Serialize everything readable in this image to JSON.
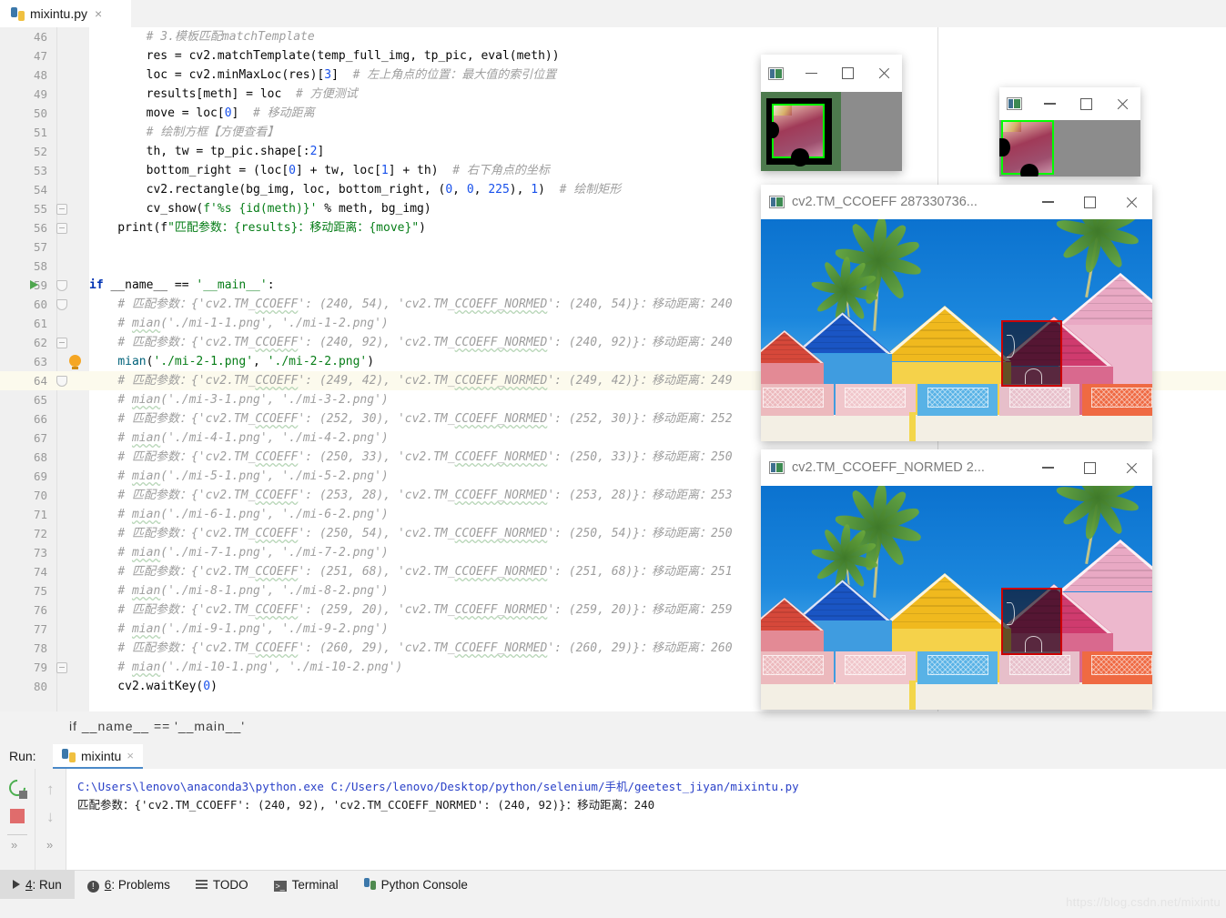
{
  "window": {
    "tab": {
      "filename": "mixintu.py",
      "close": "×",
      "icon": "python-file-icon"
    }
  },
  "editor": {
    "first_line": 46,
    "current_line": 64,
    "preview_text": "if __name__ == '__main__'",
    "lines": [
      {
        "n": 46,
        "html": "        <span class='cmt'># 3.模板匹配matchTemplate</span>"
      },
      {
        "n": 47,
        "html": "        res = cv2.matchTemplate(temp_full_img, tp_pic, eval(meth))"
      },
      {
        "n": 48,
        "html": "        loc = cv2.minMaxLoc(res)[<span class='num'>3</span>]  <span class='cmt'># 左上角点的位置：最大值的索引位置</span>"
      },
      {
        "n": 49,
        "html": "        results[meth] = loc  <span class='cmt'># 方便测试</span>"
      },
      {
        "n": 50,
        "html": "        move = loc[<span class='num'>0</span>]  <span class='cmt'># 移动距离</span>"
      },
      {
        "n": 51,
        "html": "        <span class='cmt'># 绘制方框【方便查看】</span>"
      },
      {
        "n": 52,
        "html": "        th, tw = tp_pic.shape[:<span class='num'>2</span>]"
      },
      {
        "n": 53,
        "html": "        bottom_right = (loc[<span class='num'>0</span>] + tw, loc[<span class='num'>1</span>] + th)  <span class='cmt'># 右下角点的坐标</span>"
      },
      {
        "n": 54,
        "html": "        cv2.rectangle(bg_img, loc, bottom_right, (<span class='num'>0</span>, <span class='num'>0</span>, <span class='num'>225</span>), <span class='num'>1</span>)  <span class='cmt'># 绘制矩形</span>"
      },
      {
        "n": 55,
        "html": "        cv_show(<span class='str'>f'%s {id(meth)}'</span> % meth, bg_img)",
        "fold": "minus"
      },
      {
        "n": 56,
        "html": "    print(f<span class='str'>\"匹配参数：{results}：移动距离：{move}\"</span>)",
        "fold": "minus"
      },
      {
        "n": 57,
        "html": ""
      },
      {
        "n": 58,
        "html": ""
      },
      {
        "n": 59,
        "html": "<span class='kw'>if</span> __name__ == <span class='str'>'__main__'</span>:",
        "run": true,
        "fold": "open"
      },
      {
        "n": 60,
        "html": "    <span class='cmt'># 匹配参数：{'cv2.TM_<span class='sqg'>CCOEFF</span>': (240, 54), 'cv2.TM_<span class='sqg'>CCOEFF_NORMED</span>': (240, 54)}：移动距离：240</span>",
        "fold": "open"
      },
      {
        "n": 61,
        "html": "    <span class='cmt'># <span class='sqg'>mian</span>('./mi-1-1.png', './mi-1-2.png')</span>"
      },
      {
        "n": 62,
        "html": "    <span class='cmt'># 匹配参数：{'cv2.TM_<span class='sqg'>CCOEFF</span>': (240, 92), 'cv2.TM_<span class='sqg'>CCOEFF_NORMED</span>': (240, 92)}：移动距离：240</span>",
        "fold": "minus"
      },
      {
        "n": 63,
        "html": "    <span class='fn'>mian</span>(<span class='str'>'./mi-2-1.png'</span>, <span class='str'>'./mi-2-2.png'</span>)",
        "bulb": true
      },
      {
        "n": 64,
        "html": "    <span class='cmt'># 匹配参数：{'cv2.TM_<span class='sqg'>CCOEFF</span>': (249, 42), 'cv2.TM_<span class='sqg'>CCOEFF_NORMED</span>': (249, 42)}：移动距离：249</span>",
        "hl": true,
        "fold": "open"
      },
      {
        "n": 65,
        "html": "    <span class='cmt'># <span class='sqg'>mian</span>('./mi-3-1.png', './mi-3-2.png')</span>"
      },
      {
        "n": 66,
        "html": "    <span class='cmt'># 匹配参数：{'cv2.TM_<span class='sqg'>CCOEFF</span>': (252, 30), 'cv2.TM_<span class='sqg'>CCOEFF_NORMED</span>': (252, 30)}：移动距离：252</span>"
      },
      {
        "n": 67,
        "html": "    <span class='cmt'># <span class='sqg'>mian</span>('./mi-4-1.png', './mi-4-2.png')</span>"
      },
      {
        "n": 68,
        "html": "    <span class='cmt'># 匹配参数：{'cv2.TM_<span class='sqg'>CCOEFF</span>': (250, 33), 'cv2.TM_<span class='sqg'>CCOEFF_NORMED</span>': (250, 33)}：移动距离：250</span>"
      },
      {
        "n": 69,
        "html": "    <span class='cmt'># <span class='sqg'>mian</span>('./mi-5-1.png', './mi-5-2.png')</span>"
      },
      {
        "n": 70,
        "html": "    <span class='cmt'># 匹配参数：{'cv2.TM_<span class='sqg'>CCOEFF</span>': (253, 28), 'cv2.TM_<span class='sqg'>CCOEFF_NORMED</span>': (253, 28)}：移动距离：253</span>"
      },
      {
        "n": 71,
        "html": "    <span class='cmt'># <span class='sqg'>mian</span>('./mi-6-1.png', './mi-6-2.png')</span>"
      },
      {
        "n": 72,
        "html": "    <span class='cmt'># 匹配参数：{'cv2.TM_<span class='sqg'>CCOEFF</span>': (250, 54), 'cv2.TM_<span class='sqg'>CCOEFF_NORMED</span>': (250, 54)}：移动距离：250</span>"
      },
      {
        "n": 73,
        "html": "    <span class='cmt'># <span class='sqg'>mian</span>('./mi-7-1.png', './mi-7-2.png')</span>"
      },
      {
        "n": 74,
        "html": "    <span class='cmt'># 匹配参数：{'cv2.TM_<span class='sqg'>CCOEFF</span>': (251, 68), 'cv2.TM_<span class='sqg'>CCOEFF_NORMED</span>': (251, 68)}：移动距离：251</span>"
      },
      {
        "n": 75,
        "html": "    <span class='cmt'># <span class='sqg'>mian</span>('./mi-8-1.png', './mi-8-2.png')</span>"
      },
      {
        "n": 76,
        "html": "    <span class='cmt'># 匹配参数：{'cv2.TM_<span class='sqg'>CCOEFF</span>': (259, 20), 'cv2.TM_<span class='sqg'>CCOEFF_NORMED</span>': (259, 20)}：移动距离：259</span>"
      },
      {
        "n": 77,
        "html": "    <span class='cmt'># <span class='sqg'>mian</span>('./mi-9-1.png', './mi-9-2.png')</span>"
      },
      {
        "n": 78,
        "html": "    <span class='cmt'># 匹配参数：{'cv2.TM_<span class='sqg'>CCOEFF</span>': (260, 29), 'cv2.TM_<span class='sqg'>CCOEFF_NORMED</span>': (260, 29)}：移动距离：260</span>"
      },
      {
        "n": 79,
        "html": "    <span class='cmt'># <span class='sqg'>mian</span>('./mi-10-1.png', './mi-10-2.png')</span>",
        "fold": "minus"
      },
      {
        "n": 80,
        "html": "    cv2.waitKey(<span class='num'>0</span>)"
      }
    ]
  },
  "run_panel": {
    "label": "Run:",
    "tab_name": "mixintu",
    "tab_close": "×",
    "toolbar": {
      "rerun": "rerun-icon",
      "stop": "stop-icon",
      "up": "↑",
      "down": "↓",
      "more_left": "»",
      "more_right": "»"
    },
    "console": [
      {
        "text": "C:\\Users\\lenovo\\anaconda3\\python.exe C:/Users/lenovo/Desktop/python/selenium/手机/geetest_jiyan/mixintu.py",
        "color": "blue"
      },
      {
        "text": "匹配参数：{'cv2.TM_CCOEFF': (240, 92), 'cv2.TM_CCOEFF_NORMED': (240, 92)}：移动距离：240",
        "color": "black"
      }
    ]
  },
  "bottom_bar": {
    "items": [
      {
        "label": "4: Run",
        "underline": "4",
        "icon": "run-triangle-icon",
        "selected": true
      },
      {
        "label": "6: Problems",
        "underline": "6",
        "icon": "problems-icon",
        "selected": false
      },
      {
        "label": "TODO",
        "underline": "",
        "icon": "todo-list-icon",
        "selected": false
      },
      {
        "label": "Terminal",
        "underline": "",
        "icon": "terminal-icon",
        "selected": false
      },
      {
        "label": "Python Console",
        "underline": "",
        "icon": "python-icon",
        "selected": false
      }
    ]
  },
  "watermark": "https://blog.csdn.net/mixintu",
  "cv_windows": [
    {
      "id": "template-window-1",
      "title": "",
      "buttons": [
        "minimize",
        "maximize",
        "close"
      ],
      "kind": "template",
      "background": "#8c8c8c",
      "pad_color": "#4d7a4d",
      "has_pad": true
    },
    {
      "id": "template-window-2",
      "title": "",
      "buttons": [
        "minimize",
        "maximize",
        "close"
      ],
      "kind": "template",
      "background": "#8c8c8c",
      "pad_color": "#8c8c8c",
      "has_pad": false
    },
    {
      "id": "result-window-ccoeff",
      "title": "cv2.TM_CCOEFF 287330736...",
      "buttons": [
        "minimize",
        "maximize",
        "close"
      ],
      "kind": "photo"
    },
    {
      "id": "result-window-ccoeff-normed",
      "title": "cv2.TM_CCOEFF_NORMED 2...",
      "buttons": [
        "minimize",
        "maximize",
        "close"
      ],
      "kind": "photo"
    }
  ],
  "colors": {
    "accent_blue": "#4a89c8",
    "keyword": "#0033b3",
    "string": "#067d17",
    "comment": "#9e9e9e",
    "number": "#1750eb",
    "match_rect": "#cc0000",
    "template_outline": "#00ff00",
    "editor_bg": "#ffffff",
    "gutter_bg": "#f0f0f0",
    "panel_bg": "#f2f2f2",
    "current_line": "#fcfaed"
  }
}
